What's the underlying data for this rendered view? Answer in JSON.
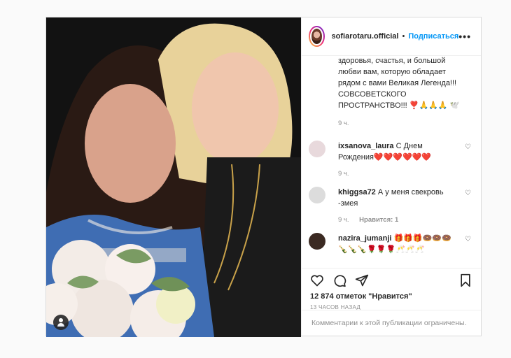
{
  "post": {
    "username": "sofiarotaru.official",
    "separator": "•",
    "follow_label": "Подписаться",
    "more_label": "•••",
    "caption": "здоровья, счастья, и большой любви вам, которую обладает рядом с вами Великая Легенда!!! СОВСОВЕТСКОГО ПРОСТРАНСТВО!!! ❣️🙏🙏🙏 🕊️",
    "caption_time": "9 ч."
  },
  "comments": [
    {
      "username": "ixsanova_laura",
      "text": "С Днем Рождения❤️❤️❤️❤️❤️❤️",
      "time": "9 ч.",
      "avatar_color": "#e8d9dc"
    },
    {
      "username": "khiggsa72",
      "text": "А у меня свекровь -змея",
      "time": "9 ч.",
      "reply_label": "Нравится: 1",
      "avatar_color": "#dcdcdc"
    },
    {
      "username": "nazira_jumanji",
      "text": "🎁🎁🎁🍩🍩🍩🍾🍾🍾🌹🌹🌹🥂🥂🥂",
      "avatar_color": "#3b2a22"
    }
  ],
  "actions": {
    "likes": "12 874 отметок \"Нравится\"",
    "posted_ago": "13 ЧАСОВ НАЗАД"
  },
  "footer": {
    "comments_limited": "Комментарии к этой публикации ограничены."
  },
  "icons": [
    "heart-icon",
    "comment-icon",
    "share-icon",
    "bookmark-icon",
    "person-tag-icon",
    "more-icon"
  ]
}
